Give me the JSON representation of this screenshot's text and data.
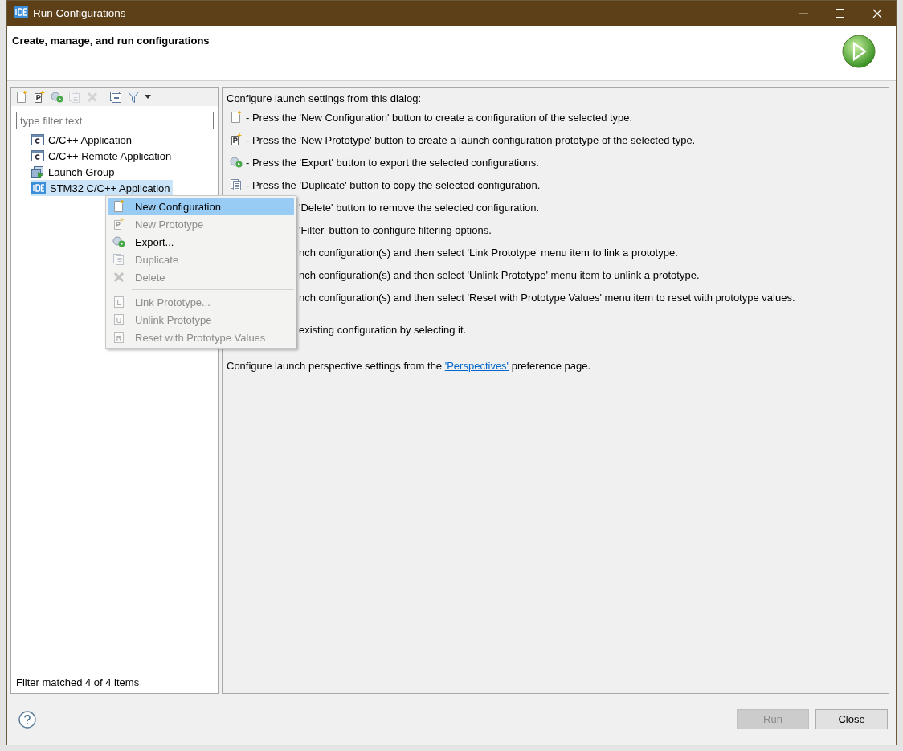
{
  "window": {
    "title": "Run Configurations"
  },
  "header": {
    "title": "Create, manage, and run configurations"
  },
  "toolbar": [
    {
      "kind": "new",
      "disabled": false
    },
    {
      "kind": "prototype",
      "disabled": false
    },
    {
      "kind": "export",
      "disabled": false
    },
    {
      "kind": "duplicate",
      "disabled": true
    },
    {
      "kind": "delete",
      "disabled": true
    },
    {
      "kind": "separator",
      "disabled": false
    },
    {
      "kind": "collapse",
      "disabled": false
    },
    {
      "kind": "filter",
      "disabled": false
    },
    {
      "kind": "dropdown",
      "disabled": false
    }
  ],
  "filter": {
    "placeholder": "type filter text"
  },
  "tree": [
    {
      "label": "C/C++ Application",
      "kind": "c-app",
      "selected": false
    },
    {
      "label": "C/C++ Remote Application",
      "kind": "c-app",
      "selected": false
    },
    {
      "label": "Launch Group",
      "kind": "launch-group",
      "selected": false
    },
    {
      "label": "STM32 C/C++ Application",
      "kind": "ide",
      "selected": true
    }
  ],
  "status": "Filter matched 4 of 4 items",
  "help": {
    "intro": "Configure launch settings from this dialog:",
    "lines": [
      {
        "kind": "new",
        "text": "- Press the 'New Configuration' button to create a configuration of the selected type."
      },
      {
        "kind": "prototype",
        "text": "- Press the 'New Prototype' button to create a launch configuration prototype of the selected type."
      },
      {
        "kind": "export",
        "text": "- Press the 'Export' button to export the selected configurations."
      },
      {
        "kind": "duplicate",
        "text": "- Press the 'Duplicate' button to copy the selected configuration."
      },
      {
        "kind": "covered",
        "text": "'Delete' button to remove the selected configuration."
      },
      {
        "kind": "covered",
        "text": "'Filter' button to configure filtering options."
      },
      {
        "kind": "covered",
        "text": "nch configuration(s) and then select 'Link Prototype' menu item to link a prototype."
      },
      {
        "kind": "covered",
        "text": "nch configuration(s) and then select 'Unlink Prototype' menu item to unlink a prototype."
      },
      {
        "kind": "covered",
        "text": "nch configuration(s) and then select 'Reset with Prototype Values' menu item to reset with prototype values."
      },
      {
        "kind": "covered-gap",
        "text": "existing configuration by selecting it."
      }
    ],
    "footer_before": "Configure launch perspective settings from the ",
    "footer_link": "'Perspectives'",
    "footer_after": " preference page."
  },
  "menu": [
    [
      {
        "label": "New Configuration",
        "kind": "new",
        "disabled": false,
        "selected": true
      },
      {
        "label": "New Prototype",
        "kind": "prototype",
        "disabled": true,
        "selected": false
      },
      {
        "label": "Export...",
        "kind": "export",
        "disabled": false,
        "selected": false
      },
      {
        "label": "Duplicate",
        "kind": "duplicate",
        "disabled": true,
        "selected": false
      },
      {
        "label": "Delete",
        "kind": "delete",
        "disabled": true,
        "selected": false
      }
    ],
    [
      {
        "label": "Link Prototype...",
        "kind": "letter",
        "letter": "L",
        "disabled": true,
        "selected": false
      },
      {
        "label": "Unlink Prototype",
        "kind": "letter",
        "letter": "U",
        "disabled": true,
        "selected": false
      },
      {
        "label": "Reset with Prototype Values",
        "kind": "letter",
        "letter": "R",
        "disabled": true,
        "selected": false
      }
    ]
  ],
  "buttons": [
    {
      "label": "Run",
      "disabled": true
    },
    {
      "label": "Close",
      "disabled": false
    }
  ]
}
